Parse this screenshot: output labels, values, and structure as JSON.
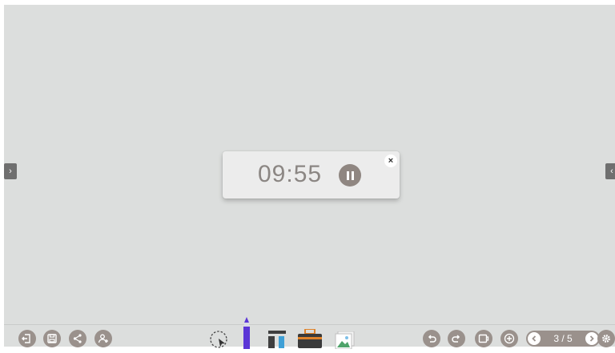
{
  "timer": {
    "time": "09:55",
    "pause_icon": "pause-icon",
    "close_glyph": "×"
  },
  "edges": {
    "left_arrow": "›",
    "right_arrow": "‹"
  },
  "toolbar": {
    "left_icons": [
      "exit-icon",
      "save-icon",
      "share-icon",
      "add-user-icon"
    ],
    "center_tools": [
      "lasso-select-icon",
      "pen-icon",
      "text-tool-icon",
      "toolbox-icon",
      "image-icon"
    ],
    "right_icons": [
      "undo-icon",
      "redo-icon",
      "screen-icon",
      "add-page-icon",
      "settings-icon"
    ],
    "page_indicator": "3 / 5"
  },
  "colors": {
    "accent": "#9a918c",
    "canvas": "#dcdedd",
    "pen": "#5b36d6"
  }
}
